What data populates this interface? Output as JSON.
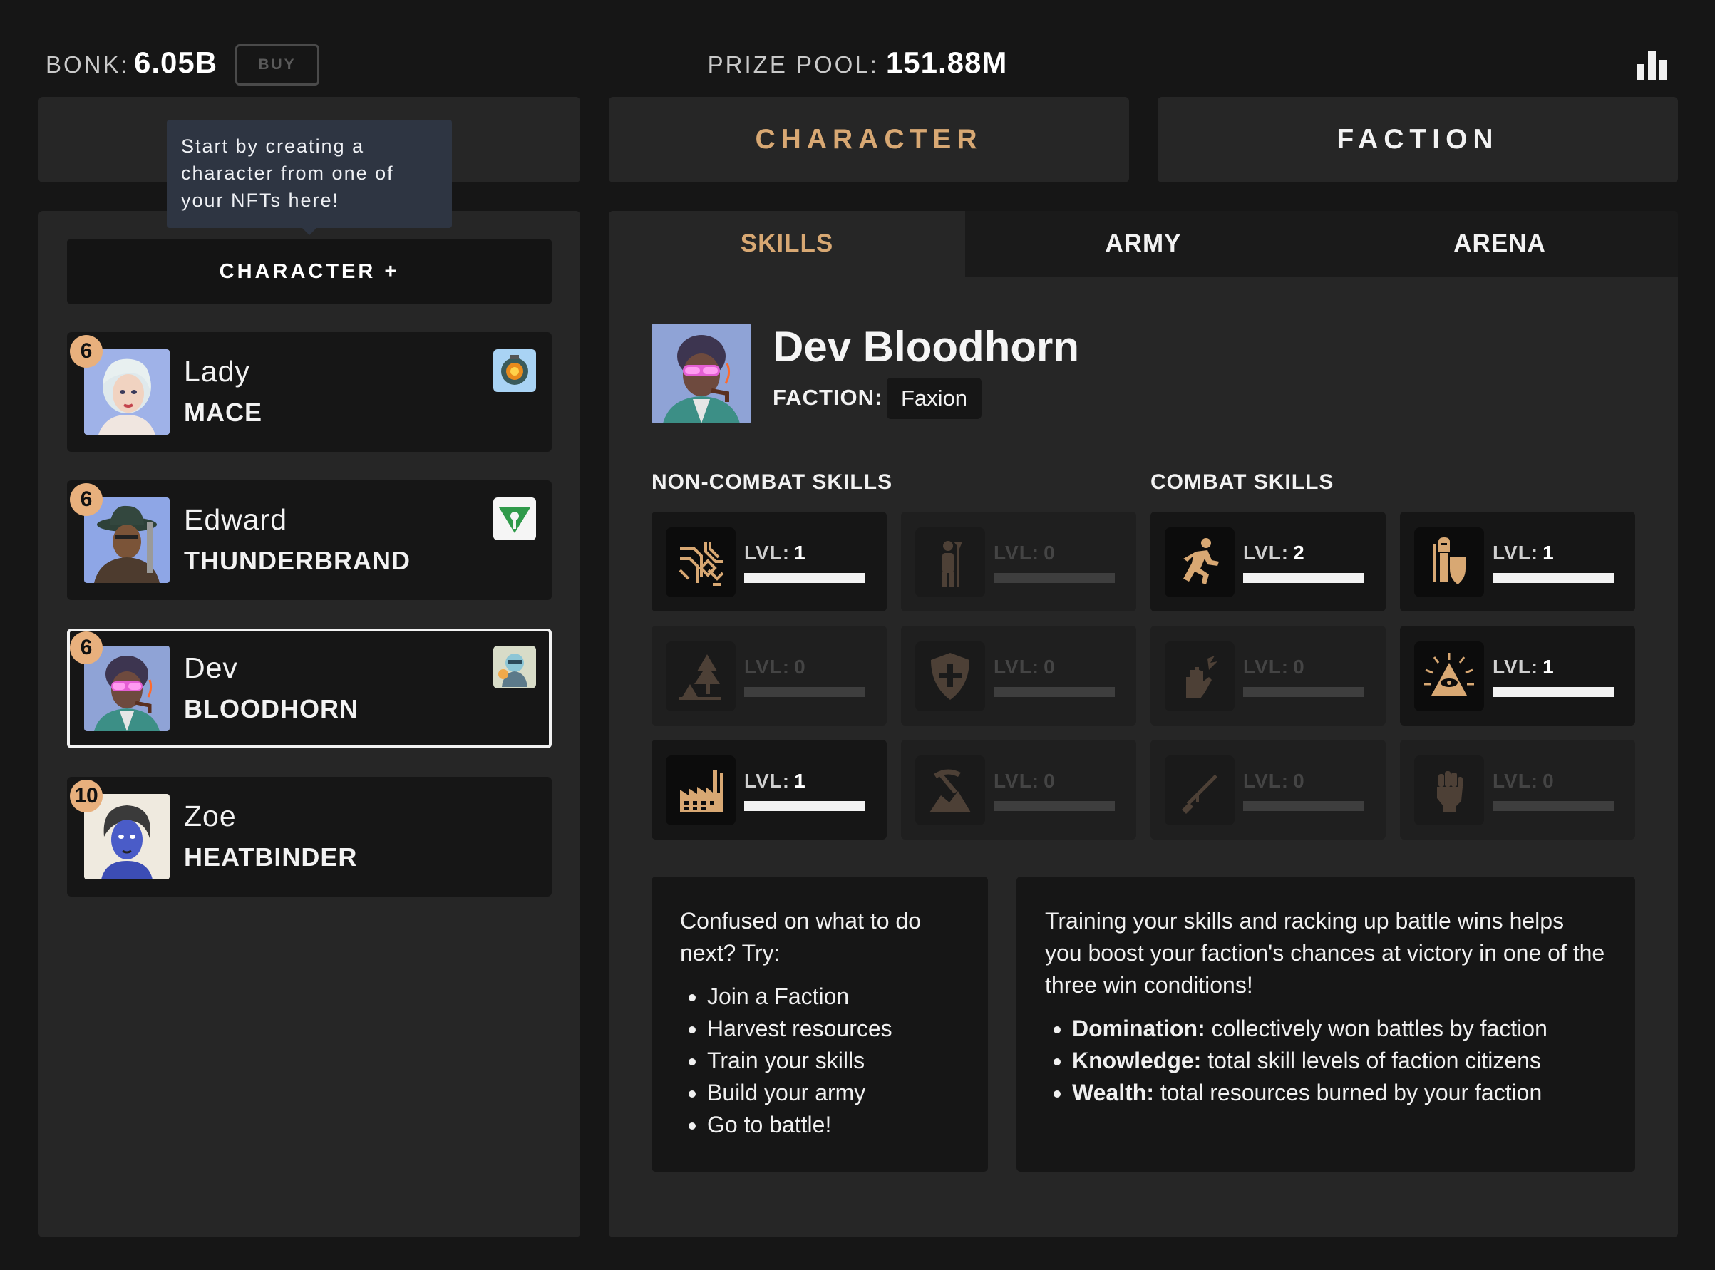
{
  "header": {
    "bonk_label": "BONK:",
    "bonk_value": "6.05B",
    "buy_label": "BUY",
    "prize_label": "PRIZE POOL:",
    "prize_value": "151.88M",
    "leaderboard_icon": "bar-chart-icon"
  },
  "nav": {
    "character": "CHARACTER",
    "faction": "FACTION"
  },
  "tooltip": "Start by creating a character from one of your NFTs here!",
  "left": {
    "add_button": "CHARACTER +",
    "characters": [
      {
        "level": "6",
        "first": "Lady",
        "last": "MACE",
        "selected": false,
        "emblem": "lantern-emblem-icon"
      },
      {
        "level": "6",
        "first": "Edward",
        "last": "THUNDERBRAND",
        "selected": false,
        "emblem": "green-crest-emblem-icon"
      },
      {
        "level": "6",
        "first": "Dev",
        "last": "BLOODHORN",
        "selected": true,
        "emblem": "robot-emblem-icon"
      },
      {
        "level": "10",
        "first": "Zoe",
        "last": "HEATBINDER",
        "selected": false,
        "emblem": ""
      }
    ]
  },
  "tabs": {
    "skills": "SKILLS",
    "army": "ARMY",
    "arena": "ARENA"
  },
  "profile": {
    "name": "Dev Bloodhorn",
    "faction_label": "FACTION:",
    "faction_value": "Faxion"
  },
  "skills": {
    "noncombat_title": "NON-COMBAT SKILLS",
    "combat_title": "COMBAT SKILLS",
    "lvl_label": "LVL:",
    "noncombat": [
      {
        "icon": "circuit-icon",
        "level": "1",
        "progress": 1.0,
        "active": true
      },
      {
        "icon": "farmer-icon",
        "level": "0",
        "progress": 0.0,
        "active": false
      },
      {
        "icon": "forest-icon",
        "level": "0",
        "progress": 0.0,
        "active": false
      },
      {
        "icon": "shield-plus-icon",
        "level": "0",
        "progress": 0.0,
        "active": false
      },
      {
        "icon": "factory-icon",
        "level": "1",
        "progress": 1.0,
        "active": true
      },
      {
        "icon": "mining-icon",
        "level": "0",
        "progress": 0.0,
        "active": false
      }
    ],
    "combat": [
      {
        "icon": "runner-icon",
        "level": "2",
        "progress": 1.0,
        "active": true
      },
      {
        "icon": "knight-shield-icon",
        "level": "1",
        "progress": 1.0,
        "active": true
      },
      {
        "icon": "magic-hand-icon",
        "level": "0",
        "progress": 0.0,
        "active": false
      },
      {
        "icon": "all-seeing-eye-icon",
        "level": "1",
        "progress": 1.0,
        "active": true
      },
      {
        "icon": "rifle-icon",
        "level": "0",
        "progress": 0.0,
        "active": false
      },
      {
        "icon": "fist-icon",
        "level": "0",
        "progress": 0.0,
        "active": false
      }
    ]
  },
  "help": {
    "intro": "Confused on what to do next? Try:",
    "items": [
      "Join a Faction",
      "Harvest resources",
      "Train your skills",
      "Build your army",
      "Go to battle!"
    ]
  },
  "info": {
    "intro": "Training your skills and racking up battle wins helps you boost your faction's chances at victory in one of the three win conditions!",
    "items": [
      {
        "term": "Domination:",
        "desc": "collectively won battles by faction"
      },
      {
        "term": "Knowledge:",
        "desc": "total skill levels of faction citizens"
      },
      {
        "term": "Wealth:",
        "desc": "total resources burned by your faction"
      }
    ]
  },
  "colors": {
    "accent": "#d8a873",
    "badge": "#e8b07d",
    "background": "#161616",
    "panel": "#262626"
  }
}
